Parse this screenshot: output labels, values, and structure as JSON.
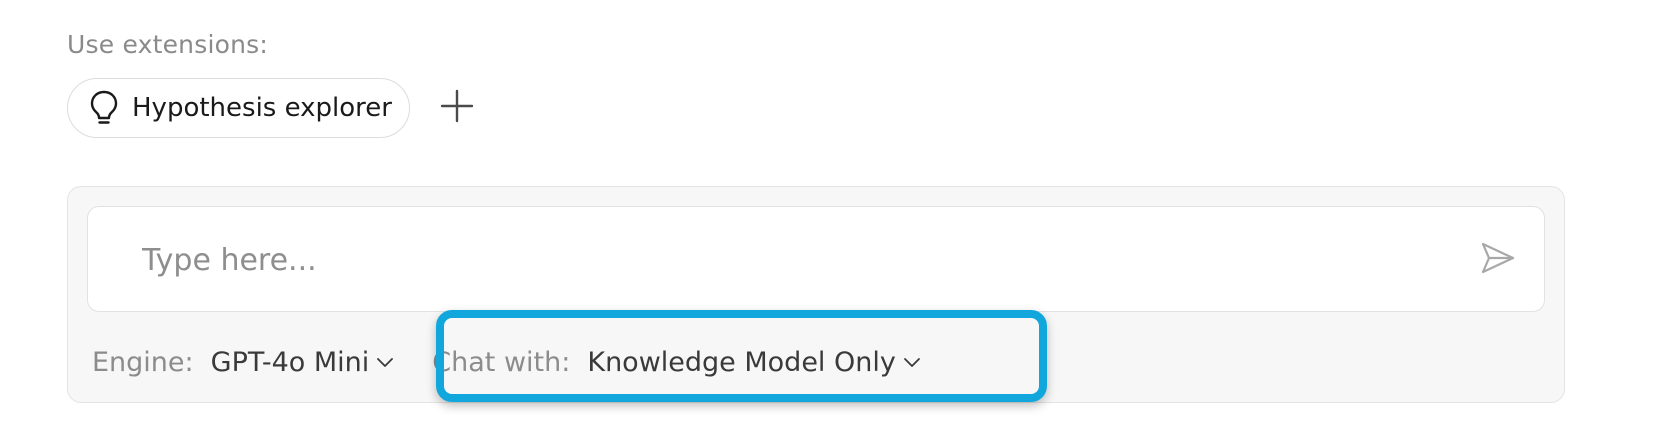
{
  "extensions": {
    "heading": "Use extensions:",
    "items": [
      {
        "label": "Hypothesis explorer",
        "icon": "lightbulb-icon"
      }
    ],
    "add_icon": "plus-icon"
  },
  "composer": {
    "placeholder": "Type here...",
    "send_icon": "send-icon",
    "engine": {
      "label": "Engine:",
      "value": "GPT-4o Mini"
    },
    "chat_with": {
      "label": "Chat with:",
      "value": "Knowledge Model Only"
    }
  },
  "colors": {
    "highlight": "#11a7dc",
    "composer_bg": "#f7f7f7",
    "muted_text": "#8c8c8c"
  }
}
